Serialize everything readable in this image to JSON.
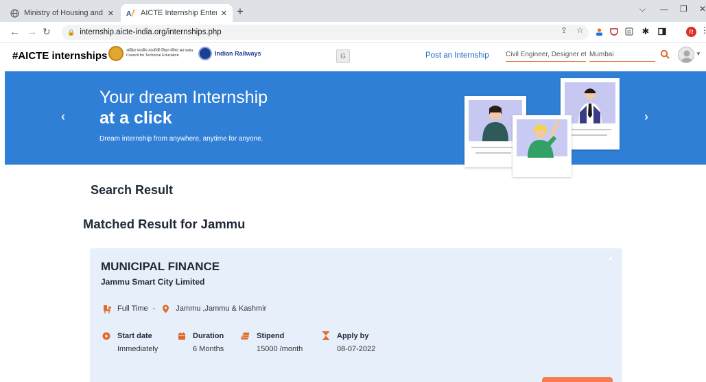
{
  "browser": {
    "tabs": [
      {
        "title": "Ministry of Housing and Urban A",
        "active": false
      },
      {
        "title": "AICTE Internship Enterprise Porta",
        "active": true
      }
    ],
    "address": "internship.aicte-india.org/internships.php",
    "profile_initial": "R"
  },
  "header": {
    "brand": "#AICTE internships",
    "aicte_logo_text": "अखिल भारतीय तकनीकी शिक्षा परिषद All India Council for Technical Education",
    "partner": "Indian Railways",
    "post_link": "Post an Internship",
    "search_role_placeholder": "Civil Engineer, Designer etc.",
    "search_location_placeholder": "Mumbai"
  },
  "banner": {
    "line1": "Your dream Internship",
    "line2": "at a click",
    "subtitle": "Dream internship from anywhere, anytime for anyone."
  },
  "content": {
    "search_heading": "Search Result",
    "matched_heading": "Matched Result for Jammu"
  },
  "job": {
    "title": "MUNICIPAL FINANCE",
    "company": "Jammu Smart City Limited",
    "type": "Full Time",
    "separator": "-",
    "location": "Jammu ,Jammu & Kashmir",
    "details": [
      {
        "label": "Start date",
        "value": "Immediately",
        "icon": "play-circle-icon"
      },
      {
        "label": "Duration",
        "value": "6 Months",
        "icon": "calendar-icon"
      },
      {
        "label": "Stipend",
        "value": "15000 /month",
        "icon": "money-icon"
      },
      {
        "label": "Apply by",
        "value": "08-07-2022",
        "icon": "hourglass-icon"
      }
    ]
  },
  "colors": {
    "accent": "#e06a2a",
    "banner": "#2f7fd6",
    "link": "#1565c0",
    "card": "#e7effa"
  }
}
